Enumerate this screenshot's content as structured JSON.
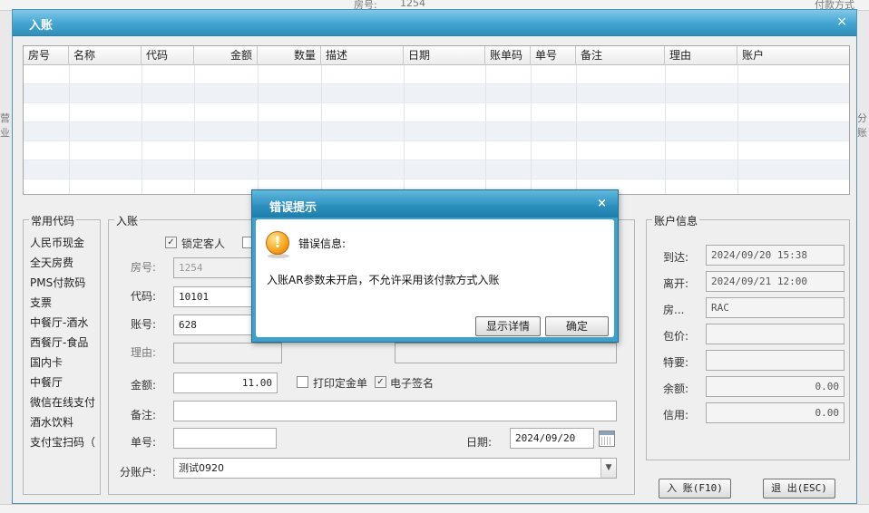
{
  "background": {
    "room_label": "房号:",
    "room_value": "1254",
    "right_label": "付款方式",
    "fragment_left": "营业",
    "fragment_right": "分账"
  },
  "window": {
    "title": "入账",
    "close_glyph": "×"
  },
  "grid": {
    "columns": [
      "房号",
      "名称",
      "代码",
      "金额",
      "数量",
      "描述",
      "日期",
      "账单码",
      "单号",
      "备注",
      "理由",
      "账户"
    ]
  },
  "code_list": {
    "title": "常用代码",
    "items": [
      "人民币现金",
      "全天房费",
      "PMS付款码",
      "支票",
      "中餐厅-酒水",
      "西餐厅-食品",
      "国内卡",
      "中餐厅",
      "微信在线支付",
      "酒水饮料",
      "支付宝扫码（"
    ]
  },
  "posting": {
    "title": "入账",
    "lock_guest_label": "锁定客人",
    "lock_guest_checked": true,
    "room_label": "房号:",
    "room_value": "1254",
    "code_label": "代码:",
    "code_value": "10101",
    "account_label": "账号:",
    "account_value": "628",
    "reason_label": "理由:",
    "reason_value": "",
    "amount_label": "金额:",
    "amount_value": "11.00",
    "print_deposit_label": "打印定金单",
    "print_deposit_checked": false,
    "esign_label": "电子签名",
    "esign_checked": true,
    "remark_label": "备注:",
    "remark_value": "",
    "voucher_label": "单号:",
    "voucher_value": "",
    "date_label": "日期:",
    "date_value": "2024/09/20",
    "subaccount_label": "分账户:",
    "subaccount_value": "测试0920"
  },
  "account_info": {
    "title": "账户信息",
    "arrival_label": "到达:",
    "arrival_value": "2024/09/20 15:38",
    "departure_label": "离开:",
    "departure_value": "2024/09/21 12:00",
    "room_label": "房...",
    "room_value": "RAC",
    "package_label": "包价:",
    "package_value": "",
    "special_label": "特要:",
    "special_value": "",
    "balance_label": "余额:",
    "balance_value": "0.00",
    "credit_label": "信用:",
    "credit_value": "0.00"
  },
  "buttons": {
    "post": "入 账(F10)",
    "exit": "退 出(ESC)"
  },
  "error_dialog": {
    "title": "错误提示",
    "close_glyph": "×",
    "heading": "错误信息:",
    "message": "入账AR参数未开启，不允许采用该付款方式入账",
    "details_button": "显示详情",
    "ok_button": "确定"
  }
}
